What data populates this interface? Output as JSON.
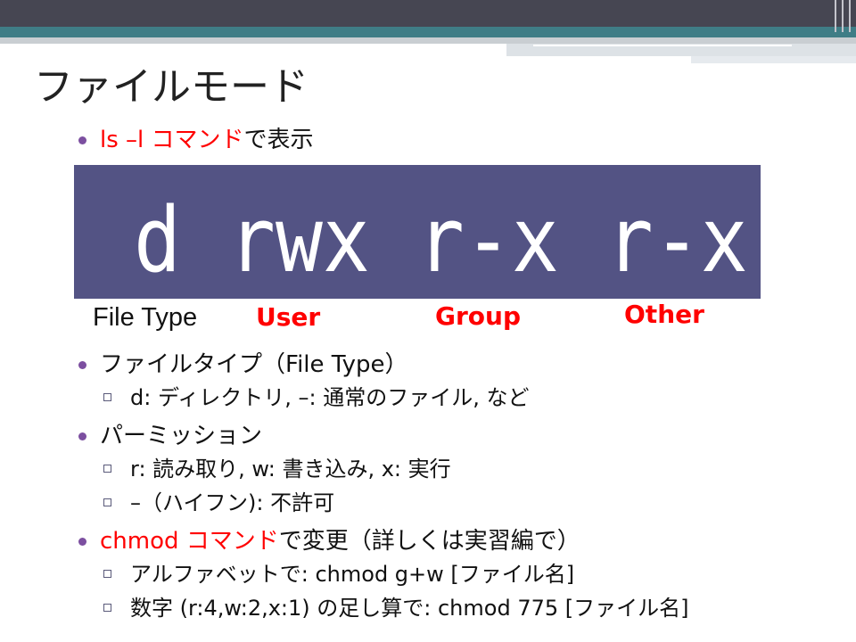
{
  "slide": {
    "title": "ファイルモード",
    "bullets": [
      {
        "red": "ls –l コマンド",
        "normal": "で表示"
      }
    ],
    "permission_box": {
      "text": "d rwx r-x r-x"
    },
    "labels": {
      "file_type": "File Type",
      "user": "User",
      "group": "Group",
      "other": "Other"
    },
    "list": {
      "file_type_heading": "ファイルタイプ（File Type）",
      "file_type_detail": "d: ディレクトリ, –: 通常のファイル, など",
      "permission_heading": "パーミッション",
      "permission_detail_1": "r: 読み取り, w: 書き込み, x: 実行",
      "permission_detail_2": "–（ハイフン): 不許可",
      "chmod_red": "chmod コマンド",
      "chmod_normal": "で変更（詳しくは実習編で）",
      "chmod_detail_1": "アルファベットで: chmod g+w [ファイル名]",
      "chmod_detail_2": "数字 (r:4,w:2,x:1) の足し算で: chmod 775 [ファイル名]"
    }
  },
  "colors": {
    "header_dark": "#464652",
    "header_teal": "#3f7d86",
    "box_background": "#535384",
    "accent_red": "#ff0000",
    "bullet_purple": "#7c4fa0"
  }
}
